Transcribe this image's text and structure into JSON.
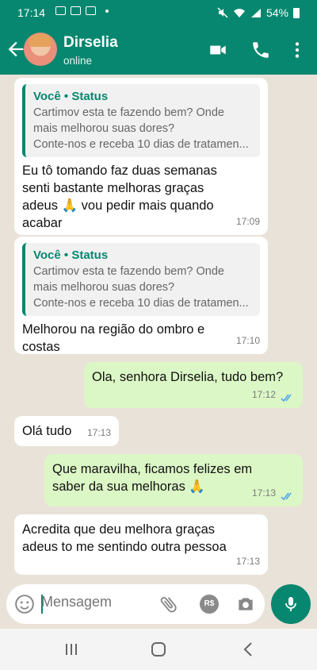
{
  "status_bar": {
    "time": "17:14",
    "battery": "54%"
  },
  "header": {
    "contact_name": "Dirselia",
    "contact_status": "online"
  },
  "messages": [
    {
      "direction": "in",
      "quote_title": "Você • Status",
      "quote_lines": [
        "Cartimov esta te fazendo bem? Onde",
        "mais melhorou suas dores?",
        "Conte-nos e receba 10 dias de tratamen..."
      ],
      "lines": [
        "Eu tô tomando faz duas semanas",
        "senti bastante melhoras graças",
        "adeus 🙏 vou pedir mais quando",
        "acabar"
      ],
      "time": "17:09"
    },
    {
      "direction": "in",
      "quote_title": "Você • Status",
      "quote_lines": [
        "Cartimov esta te fazendo bem? Onde",
        "mais melhorou suas dores?",
        "Conte-nos e receba 10 dias de tratamen..."
      ],
      "lines": [
        "Melhorou na região do ombro e",
        "costas"
      ],
      "time": "17:10"
    },
    {
      "direction": "out",
      "lines": [
        "Ola, senhora Dirselia, tudo bem?"
      ],
      "time": "17:12"
    },
    {
      "direction": "in",
      "lines": [
        "Olá tudo"
      ],
      "time": "17:13"
    },
    {
      "direction": "out",
      "lines": [
        "Que maravilha, ficamos felizes em",
        "saber da sua melhoras 🙏"
      ],
      "time": "17:13"
    },
    {
      "direction": "in",
      "lines": [
        "Acredita que deu melhora graças",
        "adeus to me sentindo outra pessoa"
      ],
      "time": "17:13"
    }
  ],
  "input": {
    "placeholder": "Mensagem"
  },
  "icons": {
    "back": "arrow-left-icon",
    "video": "video-call-icon",
    "call": "phone-icon",
    "menu": "more-vert-icon",
    "emoji": "emoji-icon",
    "attach": "paperclip-icon",
    "payment": "rs-payment-icon",
    "camera": "camera-icon",
    "mic": "mic-icon"
  },
  "colors": {
    "brand": "#07876f",
    "outgoing_bubble": "#dcf7c6",
    "incoming_bubble": "#ffffff",
    "read_ticks": "#4fa8e8"
  }
}
